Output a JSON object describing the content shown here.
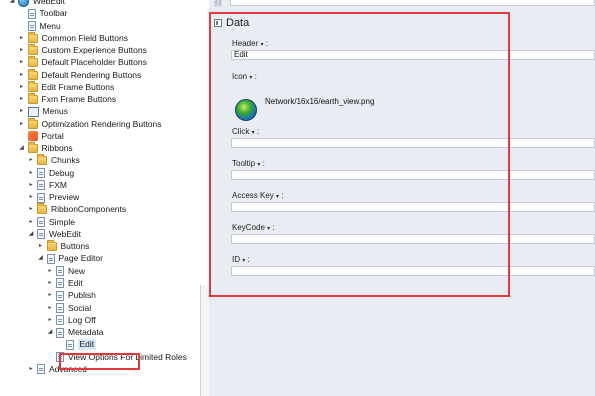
{
  "tree": {
    "nodes": [
      {
        "label": "WebEdit",
        "indent": 0,
        "arrow": "expanded",
        "icon": "globe-icon"
      },
      {
        "label": "Toolbar",
        "indent": 1,
        "arrow": "",
        "icon": "document-icon"
      },
      {
        "label": "Menu",
        "indent": 1,
        "arrow": "",
        "icon": "document-icon"
      },
      {
        "label": "Common Field Buttons",
        "indent": 1,
        "arrow": "collapsed",
        "icon": "folder-icon"
      },
      {
        "label": "Custom Experience Buttons",
        "indent": 1,
        "arrow": "collapsed",
        "icon": "folder-icon"
      },
      {
        "label": "Default Placeholder Buttons",
        "indent": 1,
        "arrow": "collapsed",
        "icon": "folder-icon"
      },
      {
        "label": "Default Rendering Buttons",
        "indent": 1,
        "arrow": "collapsed",
        "icon": "folder-icon"
      },
      {
        "label": "Edit Frame Buttons",
        "indent": 1,
        "arrow": "collapsed",
        "icon": "folder-icon"
      },
      {
        "label": "Fxm Frame Buttons",
        "indent": 1,
        "arrow": "collapsed",
        "icon": "folder-icon"
      },
      {
        "label": "Menus",
        "indent": 1,
        "arrow": "collapsed",
        "icon": "menus-icon"
      },
      {
        "label": "Optimization Rendering Buttons",
        "indent": 1,
        "arrow": "collapsed",
        "icon": "folder-icon"
      },
      {
        "label": "Portal",
        "indent": 1,
        "arrow": "",
        "icon": "portal-icon"
      },
      {
        "label": "Ribbons",
        "indent": 1,
        "arrow": "expanded",
        "icon": "folder-icon"
      },
      {
        "label": "Chunks",
        "indent": 2,
        "arrow": "collapsed",
        "icon": "folder-icon"
      },
      {
        "label": "Debug",
        "indent": 2,
        "arrow": "collapsed",
        "icon": "document-icon"
      },
      {
        "label": "FXM",
        "indent": 2,
        "arrow": "collapsed",
        "icon": "document-icon"
      },
      {
        "label": "Preview",
        "indent": 2,
        "arrow": "collapsed",
        "icon": "document-icon"
      },
      {
        "label": "RibbonComponents",
        "indent": 2,
        "arrow": "collapsed",
        "icon": "folder-icon"
      },
      {
        "label": "Simple",
        "indent": 2,
        "arrow": "collapsed",
        "icon": "document-icon"
      },
      {
        "label": "WebEdit",
        "indent": 2,
        "arrow": "expanded",
        "icon": "document-icon"
      },
      {
        "label": "Buttons",
        "indent": 3,
        "arrow": "collapsed",
        "icon": "folder-icon"
      },
      {
        "label": "Page Editor",
        "indent": 3,
        "arrow": "expanded",
        "icon": "document-icon"
      },
      {
        "label": "New",
        "indent": 4,
        "arrow": "collapsed",
        "icon": "document-icon"
      },
      {
        "label": "Edit",
        "indent": 4,
        "arrow": "collapsed",
        "icon": "document-icon"
      },
      {
        "label": "Publish",
        "indent": 4,
        "arrow": "collapsed",
        "icon": "document-icon"
      },
      {
        "label": "Social",
        "indent": 4,
        "arrow": "collapsed",
        "icon": "document-icon"
      },
      {
        "label": "Log Off",
        "indent": 4,
        "arrow": "collapsed",
        "icon": "document-icon"
      },
      {
        "label": "Metadata",
        "indent": 4,
        "arrow": "expanded",
        "icon": "document-icon"
      },
      {
        "label": "Edit",
        "indent": 5,
        "arrow": "",
        "icon": "document-icon",
        "selected": true
      },
      {
        "label": "View Options For Limited Roles",
        "indent": 4,
        "arrow": "",
        "icon": "document-icon"
      },
      {
        "label": "Advanced",
        "indent": 2,
        "arrow": "collapsed",
        "icon": "document-icon"
      }
    ]
  },
  "section": {
    "title": "Data",
    "icon": "collapse-section-icon"
  },
  "fields": {
    "header": {
      "label": "Header",
      "value": "Edit"
    },
    "icon": {
      "label": "Icon",
      "path": "Network/16x16/earth_view.png"
    },
    "click": {
      "label": "Click",
      "value": ""
    },
    "tooltip": {
      "label": "Tooltip",
      "value": ""
    },
    "access_key": {
      "label": "Access Key",
      "value": ""
    },
    "keycode": {
      "label": "KeyCode",
      "value": ""
    },
    "id": {
      "label": "ID",
      "value": ""
    },
    "label_suffix": " :",
    "caret": "▾"
  },
  "colors": {
    "highlight": "#e0393e",
    "content_bg": "#e9ecf2"
  }
}
